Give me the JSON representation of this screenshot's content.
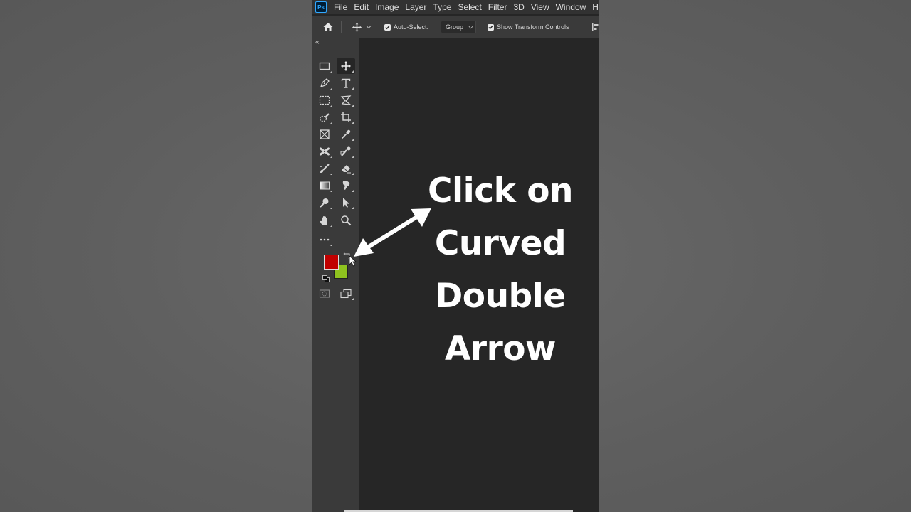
{
  "app": {
    "logo_text": "Ps"
  },
  "menu": [
    {
      "id": "file",
      "label": "File"
    },
    {
      "id": "edit",
      "label": "Edit"
    },
    {
      "id": "image",
      "label": "Image"
    },
    {
      "id": "layer",
      "label": "Layer"
    },
    {
      "id": "type",
      "label": "Type"
    },
    {
      "id": "select",
      "label": "Select"
    },
    {
      "id": "filter",
      "label": "Filter"
    },
    {
      "id": "3d",
      "label": "3D"
    },
    {
      "id": "view",
      "label": "View"
    },
    {
      "id": "window",
      "label": "Window"
    },
    {
      "id": "help",
      "label": "Help"
    }
  ],
  "options_bar": {
    "auto_select_label": "Auto-Select:",
    "auto_select_checked": true,
    "group_dropdown_value": "Group",
    "show_transform_label": "Show Transform Controls",
    "show_transform_checked": true
  },
  "toolbar": {
    "collapse_icon": "«",
    "tools": [
      {
        "name": "artboard-tool",
        "icon": "rect-icon"
      },
      {
        "name": "move-tool",
        "icon": "move-icon",
        "active": true
      },
      {
        "name": "pen-tool",
        "icon": "pen-icon"
      },
      {
        "name": "type-tool",
        "icon": "type-icon"
      },
      {
        "name": "marquee-tool",
        "icon": "marquee-icon"
      },
      {
        "name": "lasso-tool",
        "icon": "lasso-icon"
      },
      {
        "name": "quick-select-tool",
        "icon": "quick-select-icon"
      },
      {
        "name": "crop-tool",
        "icon": "crop-icon"
      },
      {
        "name": "frame-tool",
        "icon": "frame-icon"
      },
      {
        "name": "eyedropper-tool",
        "icon": "eyedropper-icon"
      },
      {
        "name": "healing-tool",
        "icon": "healing-icon"
      },
      {
        "name": "clone-stamp-tool",
        "icon": "stamp-icon"
      },
      {
        "name": "brush-tool",
        "icon": "brush-icon"
      },
      {
        "name": "eraser-tool",
        "icon": "eraser-icon"
      },
      {
        "name": "gradient-tool",
        "icon": "gradient-icon"
      },
      {
        "name": "smudge-tool",
        "icon": "smudge-icon"
      },
      {
        "name": "dodge-tool",
        "icon": "dodge-icon"
      },
      {
        "name": "path-select-tool",
        "icon": "arrow-icon"
      },
      {
        "name": "hand-tool",
        "icon": "hand-icon"
      },
      {
        "name": "zoom-tool",
        "icon": "zoom-icon"
      },
      {
        "name": "edit-toolbar",
        "icon": "more-icon"
      }
    ],
    "foreground_color": "#c00000",
    "background_color": "#8fc31f"
  },
  "overlay": {
    "lines": [
      "Click on",
      "Curved",
      "Double",
      "Arrow"
    ],
    "color": "#ffffff"
  }
}
